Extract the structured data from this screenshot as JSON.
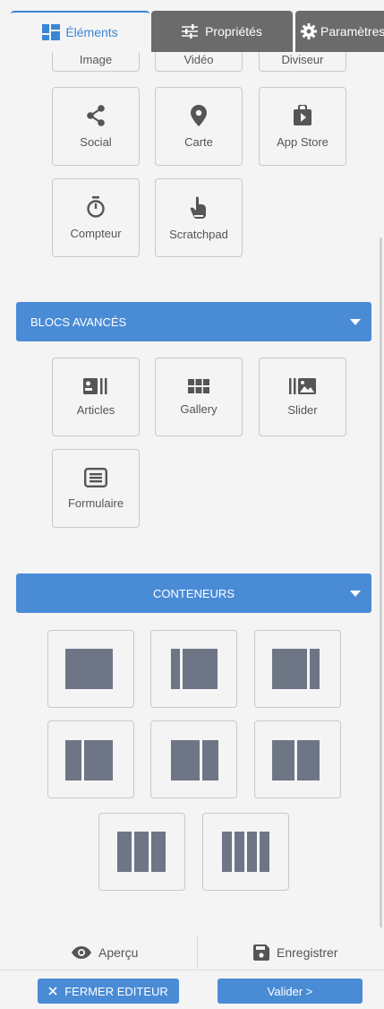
{
  "tabs": {
    "elements": "Éléments",
    "properties": "Propriétés",
    "settings": "Paramètres"
  },
  "partial_tiles": [
    "Image",
    "Vidéo",
    "Diviseur"
  ],
  "basic_tiles": [
    {
      "label": "Social",
      "icon": "share-icon"
    },
    {
      "label": "Carte",
      "icon": "map-pin-icon"
    },
    {
      "label": "App Store",
      "icon": "app-store-icon"
    },
    {
      "label": "Compteur",
      "icon": "timer-icon"
    },
    {
      "label": "Scratchpad",
      "icon": "hand-pointer-icon"
    }
  ],
  "advanced": {
    "title": "BLOCS AVANCÉS",
    "tiles": [
      {
        "label": "Articles",
        "icon": "articles-icon"
      },
      {
        "label": "Gallery",
        "icon": "gallery-icon"
      },
      {
        "label": "Slider",
        "icon": "slider-icon"
      },
      {
        "label": "Formulaire",
        "icon": "form-icon"
      }
    ]
  },
  "containers": {
    "title": "CONTENEURS",
    "layouts": [
      "1-column",
      "left-sidebar",
      "right-sidebar",
      "1-2-columns",
      "2-1-columns",
      "2-columns",
      "3-columns",
      "4-columns"
    ]
  },
  "footer": {
    "preview": "Aperçu",
    "save": "Enregistrer",
    "close": "FERMER EDITEUR",
    "validate": "Valider >"
  },
  "colors": {
    "accent": "#4a8bd6",
    "tab_inactive": "#6b6b6b",
    "icon": "#555555",
    "block": "#6e7585"
  }
}
